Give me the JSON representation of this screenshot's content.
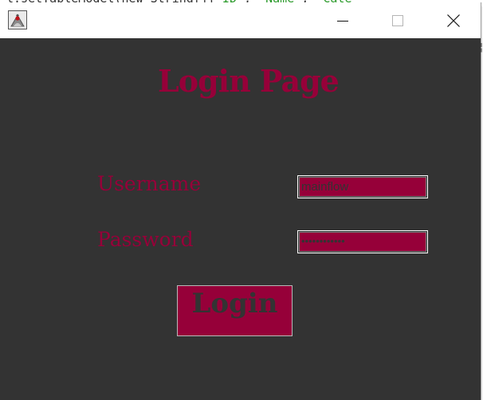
{
  "background": {
    "code_line": [
      {
        "text": "l.setTableModel(new String[]{",
        "type": "plain"
      },
      {
        "text": "\"ID\"",
        "type": "str"
      },
      {
        "text": ", ",
        "type": "plain"
      },
      {
        "text": "\"Name\"",
        "type": "str"
      },
      {
        "text": ", ",
        "type": "plain"
      },
      {
        "text": "\"Cate",
        "type": "str"
      }
    ],
    "right_glyph": "¦"
  },
  "titlebar": {
    "icon": "java-coffee-cup-icon",
    "minimize_icon": "minimize-icon",
    "maximize_icon": "maximize-icon",
    "close_icon": "close-icon"
  },
  "form": {
    "title": "Login Page",
    "username_label": "Username",
    "username_value": "mainflow",
    "password_label": "Password",
    "password_mask": "••••••••••••",
    "login_label": "Login"
  },
  "colors": {
    "window_bg": "#333333",
    "accent": "#960039",
    "titlebar_bg": "#ffffff"
  }
}
